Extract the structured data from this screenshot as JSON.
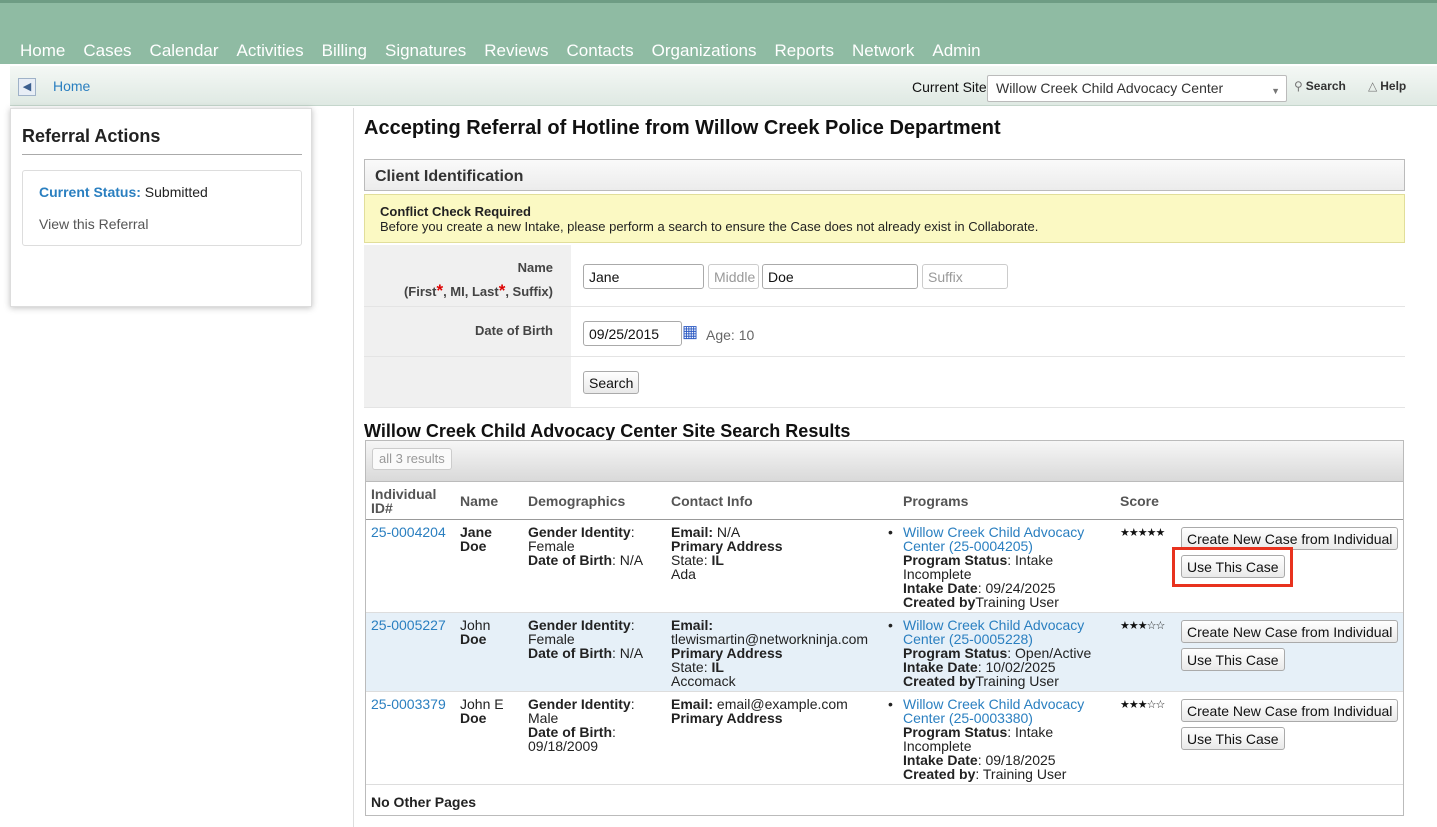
{
  "nav": {
    "items": [
      "Home",
      "Cases",
      "Calendar",
      "Activities",
      "Billing",
      "Signatures",
      "Reviews",
      "Contacts",
      "Organizations",
      "Reports",
      "Network",
      "Admin"
    ]
  },
  "subbar": {
    "breadcrumb": "Home",
    "current_site_label": "Current Site",
    "current_site_value": "Willow Creek Child Advocacy Center",
    "search_label": "Search",
    "help_label": "Help"
  },
  "sidebar": {
    "title": "Referral Actions",
    "status_label": "Current Status:",
    "status_value": "Submitted",
    "view_link": "View this Referral"
  },
  "page": {
    "title": "Accepting Referral of Hotline from Willow Creek Police Department"
  },
  "client_identification": {
    "heading": "Client Identification",
    "conflict_title": "Conflict Check Required",
    "conflict_text": "Before you create a new Intake, please perform a search to ensure the Case does not already exist in Collaborate.",
    "name_label": "Name",
    "name_sub_first": "(First",
    "name_sub_mid": ", MI, Last",
    "name_sub_end": ", Suffix)",
    "required_mark": "*",
    "first_value": "Jane",
    "middle_placeholder": "Middle",
    "last_value": "Doe",
    "suffix_placeholder": "Suffix",
    "dob_label": "Date of Birth",
    "dob_value": "09/25/2015",
    "age_text": "Age: 10",
    "search_button": "Search"
  },
  "results": {
    "title": "Willow Creek Child Advocacy Center Site Search Results",
    "count_label": "all 3 results",
    "columns": {
      "id_line1": "Individual",
      "id_line2": "ID#",
      "name": "Name",
      "demographics": "Demographics",
      "contact": "Contact Info",
      "programs": "Programs",
      "score": "Score"
    },
    "create_label": "Create New Case from Individual",
    "use_label": "Use This Case",
    "footer": "No Other Pages",
    "rows": [
      {
        "id": "25-0004204",
        "first": "Jane",
        "last": "Doe",
        "gender_label": "Gender Identity",
        "gender_value": "Female",
        "dob_label": "Date of Birth",
        "dob_value": ": N/A",
        "email_label": "Email:",
        "email_value": "N/A",
        "address_label": "Primary Address",
        "state_label": "State:",
        "state_value": "IL",
        "county": "Ada",
        "program_line1": "Willow Creek Child Advocacy",
        "program_line2": "Center (25-0004205)",
        "program_status_label": "Program Status",
        "program_status_value": ": Intake",
        "program_status_cont": "Incomplete",
        "intake_label": "Intake Date",
        "intake_value": ": 09/24/2025",
        "created_label": "Created by",
        "created_value": "Training User",
        "score": 5
      },
      {
        "id": "25-0005227",
        "first": "John",
        "last": "Doe",
        "gender_label": "Gender Identity",
        "gender_value": "Female",
        "dob_label": "Date of Birth",
        "dob_value": ": N/A",
        "email_label": "Email:",
        "email_value": "tlewismartin@networkninja.com",
        "address_label": "Primary Address",
        "state_label": "State:",
        "state_value": "IL",
        "county": "Accomack",
        "program_line1": "Willow Creek Child Advocacy",
        "program_line2": "Center (25-0005228)",
        "program_status_label": "Program Status",
        "program_status_value": ": Open/Active",
        "intake_label": "Intake Date",
        "intake_value": ": 10/02/2025",
        "created_label": "Created by",
        "created_value": "Training User",
        "score": 3
      },
      {
        "id": "25-0003379",
        "first": "John E",
        "last": "Doe",
        "gender_label": "Gender Identity",
        "gender_value": "Male",
        "dob_label": "Date of Birth",
        "dob_value": ":",
        "dob_value2": "09/18/2009",
        "email_label": "Email:",
        "email_value": "email@example.com",
        "address_label": "Primary Address",
        "program_line1": "Willow Creek Child Advocacy",
        "program_line2": "Center (25-0003380)",
        "program_status_label": "Program Status",
        "program_status_value": ": Intake",
        "program_status_cont": "Incomplete",
        "intake_label": "Intake Date",
        "intake_value": ": 09/18/2025",
        "created_label": "Created by",
        "created_value": ": Training User",
        "score": 3
      }
    ]
  },
  "colors": {
    "nav_bg": "#8fbba3",
    "link": "#2a7fc0",
    "conflict_bg": "#fbf9c3",
    "alt_row": "#e6f0f8",
    "highlight": "#e8321e"
  }
}
